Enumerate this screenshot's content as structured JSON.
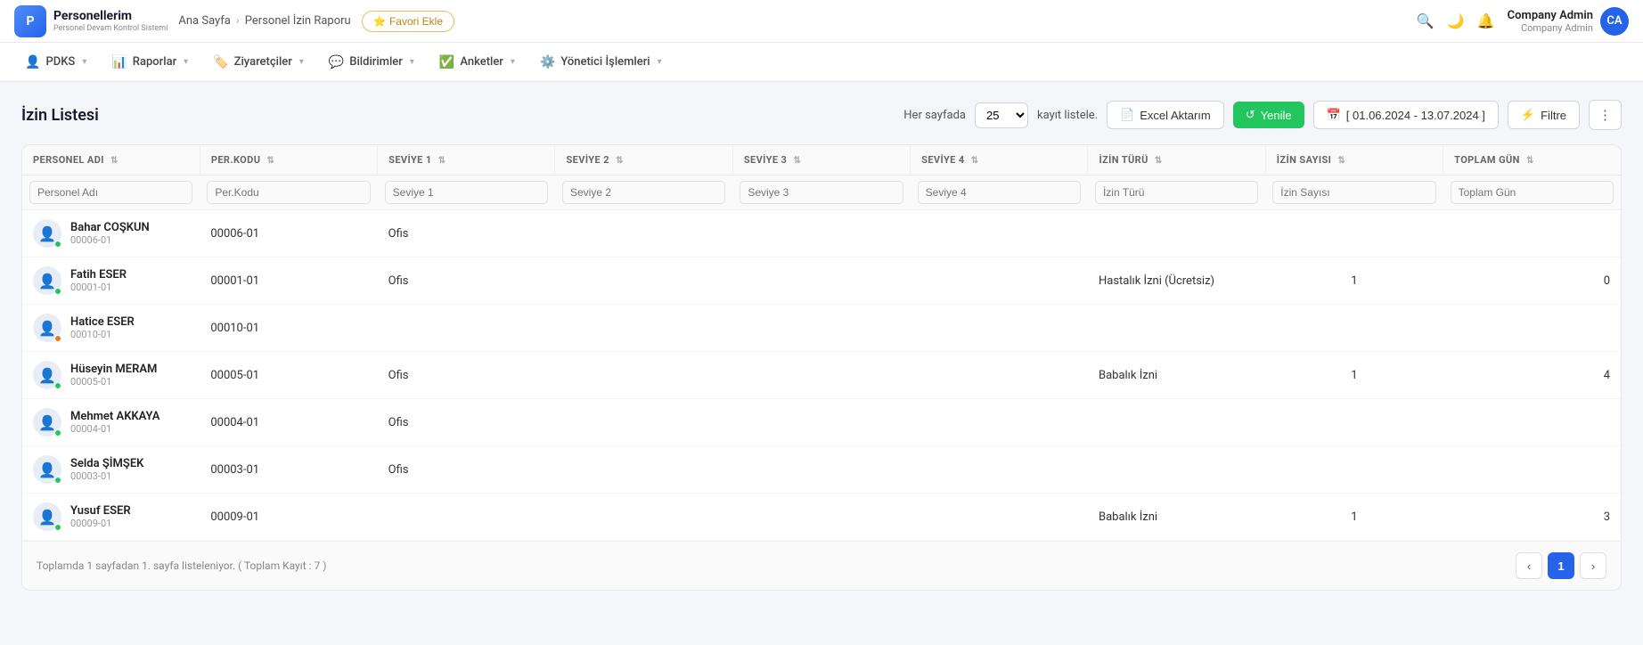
{
  "app": {
    "logo_initials": "P",
    "logo_title": "Personellerim",
    "logo_subtitle": "Personel Devam Kontrol Sistemi"
  },
  "breadcrumb": {
    "home": "Ana Sayfa",
    "separator": "›",
    "current": "Personel İzin Raporu"
  },
  "favori_btn": "⭐ Favori Ekle",
  "user": {
    "name": "Company Admin",
    "company": "Company Admin",
    "initials": "CA"
  },
  "nav_icons": {
    "search": "🔍",
    "moon": "🌙",
    "bell": "🔔"
  },
  "secondary_nav": [
    {
      "id": "pdks",
      "icon": "👤",
      "label": "PDKS",
      "has_dropdown": true
    },
    {
      "id": "raporlar",
      "icon": "📊",
      "label": "Raporlar",
      "has_dropdown": true
    },
    {
      "id": "ziyaretciler",
      "icon": "🏷️",
      "label": "Ziyaretçiler",
      "has_dropdown": true
    },
    {
      "id": "bildirimler",
      "icon": "💬",
      "label": "Bildirimler",
      "has_dropdown": true
    },
    {
      "id": "anketler",
      "icon": "✅",
      "label": "Anketler",
      "has_dropdown": true
    },
    {
      "id": "yonetici",
      "icon": "⚙️",
      "label": "Yönetici İşlemleri",
      "has_dropdown": true
    }
  ],
  "page": {
    "title": "İzin Listesi",
    "per_page_label": "Her sayfada",
    "per_page_value": "25",
    "kayit_label": "kayıt listele.",
    "excel_btn": "Excel Aktarım",
    "yenile_btn": "Yenile",
    "date_range": "[ 01.06.2024 - 13.07.2024 ]",
    "filtre_btn": "Filtre",
    "more_btn": "⋮"
  },
  "table": {
    "columns": [
      {
        "id": "personel_adi",
        "label": "PERSONEL ADI",
        "sortable": true
      },
      {
        "id": "per_kodu",
        "label": "PER.KODU",
        "sortable": true
      },
      {
        "id": "seviye1",
        "label": "SEVİYE 1",
        "sortable": true
      },
      {
        "id": "seviye2",
        "label": "SEVİYE 2",
        "sortable": true
      },
      {
        "id": "seviye3",
        "label": "SEVİYE 3",
        "sortable": true
      },
      {
        "id": "seviye4",
        "label": "SEVİYE 4",
        "sortable": true
      },
      {
        "id": "izin_turu",
        "label": "İZİN TÜRÜ",
        "sortable": true
      },
      {
        "id": "izin_sayisi",
        "label": "İZİN SAYISI",
        "sortable": true
      },
      {
        "id": "toplam_gun",
        "label": "TOPLAM GÜN",
        "sortable": true
      }
    ],
    "filters": {
      "personel_adi": "Personel Adı",
      "per_kodu": "Per.Kodu",
      "seviye1": "Seviye 1",
      "seviye2": "Seviye 2",
      "seviye3": "Seviye 3",
      "seviye4": "Seviye 4",
      "izin_turu": "İzin Türü",
      "izin_sayisi": "İzin Sayısı",
      "toplam_gun": "Toplam Gün"
    },
    "rows": [
      {
        "name": "Bahar COŞKUN",
        "code_primary": "00006-01",
        "status": "green",
        "per_kodu": "00006-01",
        "seviye1": "Ofis",
        "seviye2": "",
        "seviye3": "",
        "seviye4": "",
        "izin_turu": "",
        "izin_sayisi": "",
        "toplam_gun": ""
      },
      {
        "name": "Fatih ESER",
        "code_primary": "00001-01",
        "status": "green",
        "per_kodu": "00001-01",
        "seviye1": "Ofis",
        "seviye2": "",
        "seviye3": "",
        "seviye4": "",
        "izin_turu": "Hastalık İzni (Ücretsiz)",
        "izin_sayisi": "1",
        "toplam_gun": "0"
      },
      {
        "name": "Hatice ESER",
        "code_primary": "00010-01",
        "status": "orange",
        "per_kodu": "00010-01",
        "seviye1": "",
        "seviye2": "",
        "seviye3": "",
        "seviye4": "",
        "izin_turu": "",
        "izin_sayisi": "",
        "toplam_gun": ""
      },
      {
        "name": "Hüseyin MERAM",
        "code_primary": "00005-01",
        "status": "green",
        "per_kodu": "00005-01",
        "seviye1": "Ofis",
        "seviye2": "",
        "seviye3": "",
        "seviye4": "",
        "izin_turu": "Babalık İzni",
        "izin_sayisi": "1",
        "toplam_gun": "4"
      },
      {
        "name": "Mehmet AKKAYA",
        "code_primary": "00004-01",
        "status": "green",
        "per_kodu": "00004-01",
        "seviye1": "Ofis",
        "seviye2": "",
        "seviye3": "",
        "seviye4": "",
        "izin_turu": "",
        "izin_sayisi": "",
        "toplam_gun": ""
      },
      {
        "name": "Selda ŞİMŞEK",
        "code_primary": "00003-01",
        "status": "green",
        "per_kodu": "00003-01",
        "seviye1": "Ofis",
        "seviye2": "",
        "seviye3": "",
        "seviye4": "",
        "izin_turu": "",
        "izin_sayisi": "",
        "toplam_gun": ""
      },
      {
        "name": "Yusuf ESER",
        "code_primary": "00009-01",
        "status": "green",
        "per_kodu": "00009-01",
        "seviye1": "",
        "seviye2": "",
        "seviye3": "",
        "seviye4": "",
        "izin_turu": "Babalık İzni",
        "izin_sayisi": "1",
        "toplam_gun": "3"
      }
    ]
  },
  "footer": {
    "info": "Toplamda 1 sayfadan 1. sayfa listeleniyor. ( Toplam Kayıt : 7 )",
    "prev_btn": "‹",
    "next_btn": "›",
    "current_page": "1"
  }
}
